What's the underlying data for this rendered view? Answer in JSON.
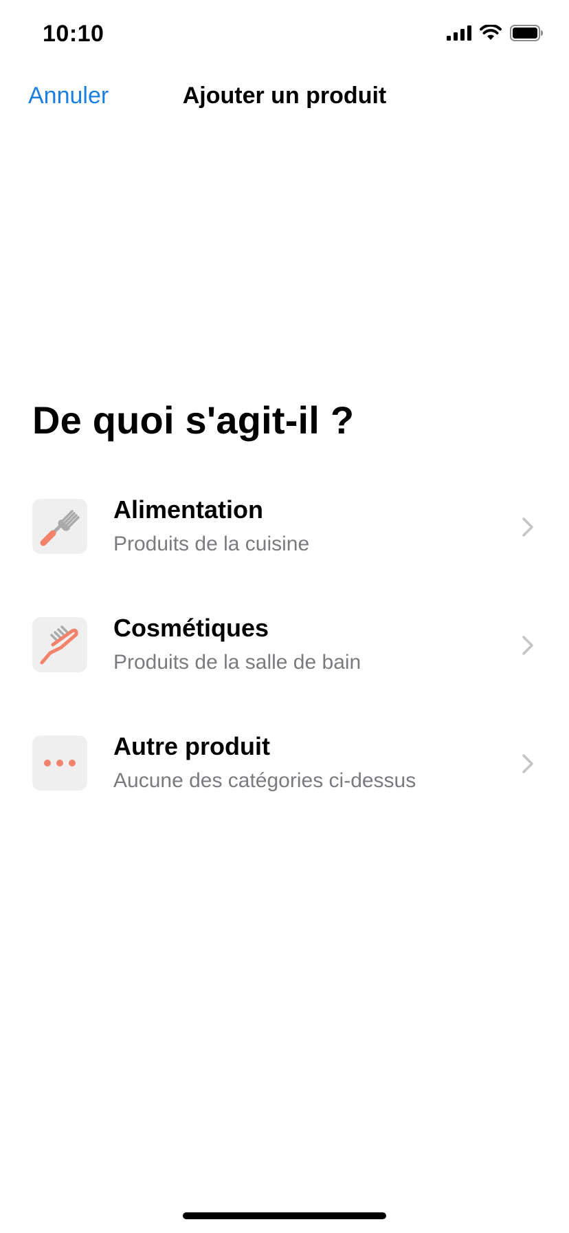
{
  "status_bar": {
    "time": "10:10",
    "signal_icon": "cellular-signal-icon",
    "wifi_icon": "wifi-icon",
    "battery_icon": "battery-icon"
  },
  "nav": {
    "cancel_label": "Annuler",
    "title": "Ajouter un produit"
  },
  "question": "De quoi s'agit-il ?",
  "categories": [
    {
      "title": "Alimentation",
      "subtitle": "Produits de la cuisine",
      "icon": "fork-icon"
    },
    {
      "title": "Cosmétiques",
      "subtitle": "Produits de la salle de bain",
      "icon": "toothbrush-icon"
    },
    {
      "title": "Autre produit",
      "subtitle": "Aucune des catégories ci-dessus",
      "icon": "more-dots-icon"
    }
  ],
  "colors": {
    "accent": "#1a7fe0",
    "icon_accent": "#f2826a",
    "icon_gray": "#aaaaaa",
    "icon_background": "#efefef",
    "subtitle": "#7a7a7f",
    "chevron": "#c4c4c7"
  }
}
